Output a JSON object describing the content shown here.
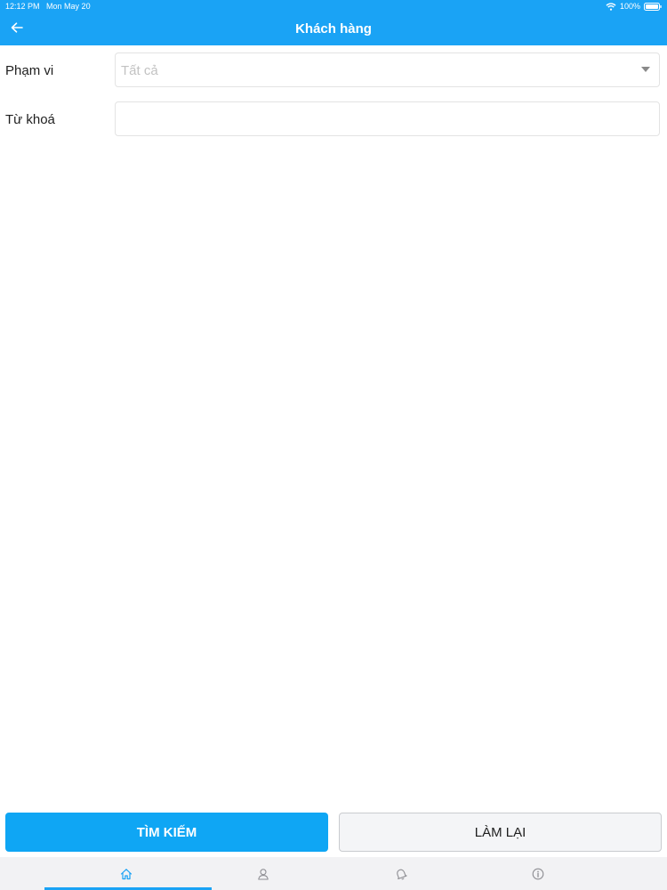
{
  "status_bar": {
    "time": "12:12 PM",
    "date": "Mon May 20",
    "battery": "100%"
  },
  "header": {
    "title": "Khách hàng",
    "back_icon": "arrow-left-icon"
  },
  "form": {
    "scope": {
      "label": "Phạm vi",
      "value": "Tất cả",
      "icon": "caret-down-icon"
    },
    "keyword": {
      "label": "Từ khoá",
      "value": "",
      "placeholder": ""
    }
  },
  "actions": {
    "search_label": "TÌM KIẾM",
    "reset_label": "LÀM LẠI"
  },
  "tab_bar": {
    "active_tab": "home",
    "tabs": [
      {
        "id": "home",
        "icon": "home-icon"
      },
      {
        "id": "profile",
        "icon": "user-icon"
      },
      {
        "id": "notifications",
        "icon": "bell-icon"
      },
      {
        "id": "info",
        "icon": "info-icon"
      }
    ]
  },
  "colors": {
    "primary": "#1aa3f5",
    "button_primary": "#0fa6f4",
    "placeholder_text": "#c2c2c2",
    "field_border": "#e3e3e3",
    "inactive_icon": "#8e8e93"
  }
}
